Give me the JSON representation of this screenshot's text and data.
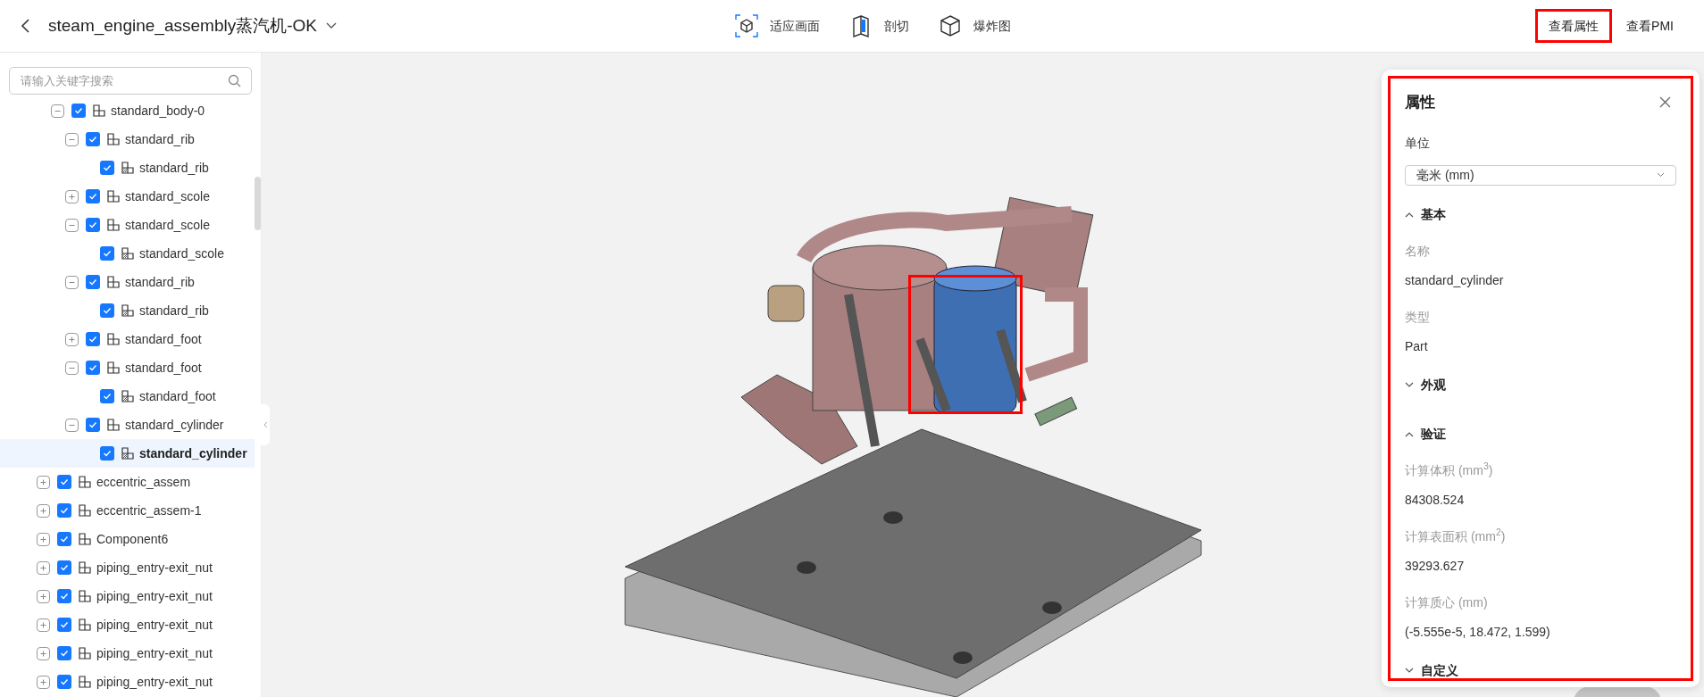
{
  "header": {
    "title": "steam_engine_assembly蒸汽机-OK",
    "tools": [
      {
        "kind": "fit",
        "label": "适应画面"
      },
      {
        "kind": "section",
        "label": "剖切"
      },
      {
        "kind": "explode",
        "label": "爆炸图"
      }
    ],
    "actions": [
      {
        "label": "查看属性",
        "selected": true
      },
      {
        "label": "查看PMI",
        "selected": false
      }
    ]
  },
  "sidebar": {
    "search": {
      "placeholder": "请输入关键字搜索"
    },
    "tree_continued": [
      {
        "label": "standard_body-0",
        "kind": "assembly",
        "expanded": true,
        "checked": true,
        "selected": false,
        "children": [
          {
            "label": "standard_rib",
            "kind": "assembly",
            "expanded": true,
            "checked": true,
            "selected": false,
            "children": [
              {
                "label": "standard_rib",
                "kind": "part",
                "checked": true,
                "selected": false
              }
            ]
          },
          {
            "label": "standard_scole",
            "kind": "assembly",
            "expanded": false,
            "checked": true,
            "selected": false
          },
          {
            "label": "standard_scole",
            "kind": "assembly",
            "expanded": true,
            "checked": true,
            "selected": false,
            "children": [
              {
                "label": "standard_scole",
                "kind": "part",
                "checked": true,
                "selected": false
              }
            ]
          },
          {
            "label": "standard_rib",
            "kind": "assembly",
            "expanded": true,
            "checked": true,
            "selected": false,
            "children": [
              {
                "label": "standard_rib",
                "kind": "part",
                "checked": true,
                "selected": false
              }
            ]
          },
          {
            "label": "standard_foot",
            "kind": "assembly",
            "expanded": false,
            "checked": true,
            "selected": false
          },
          {
            "label": "standard_foot",
            "kind": "assembly",
            "expanded": true,
            "checked": true,
            "selected": false,
            "children": [
              {
                "label": "standard_foot",
                "kind": "part",
                "checked": true,
                "selected": false
              }
            ]
          },
          {
            "label": "standard_cylinder",
            "kind": "assembly",
            "expanded": true,
            "checked": true,
            "selected": false,
            "children": [
              {
                "label": "standard_cylinder",
                "kind": "part",
                "checked": true,
                "selected": true
              }
            ]
          }
        ]
      }
    ],
    "tree": [
      {
        "label": "eccentric_assem",
        "kind": "assembly",
        "expanded": false,
        "checked": true,
        "selected": false
      },
      {
        "label": "eccentric_assem-1",
        "kind": "assembly",
        "expanded": false,
        "checked": true,
        "selected": false
      },
      {
        "label": "Component6",
        "kind": "assembly",
        "expanded": false,
        "checked": true,
        "selected": false
      },
      {
        "label": "piping_entry-exit_nut",
        "kind": "assembly",
        "expanded": false,
        "checked": true,
        "selected": false
      },
      {
        "label": "piping_entry-exit_nut",
        "kind": "assembly",
        "expanded": false,
        "checked": true,
        "selected": false
      },
      {
        "label": "piping_entry-exit_nut",
        "kind": "assembly",
        "expanded": false,
        "checked": true,
        "selected": false
      },
      {
        "label": "piping_entry-exit_nut",
        "kind": "assembly",
        "expanded": false,
        "checked": true,
        "selected": false
      },
      {
        "label": "piping_entry-exit_nut",
        "kind": "assembly",
        "expanded": false,
        "checked": true,
        "selected": false
      }
    ]
  },
  "viewport": {
    "highlight": true
  },
  "panel": {
    "title": "属性",
    "highlight": true,
    "unit_label": "单位",
    "unit_value": "毫米 (mm)",
    "sections": [
      {
        "title": "基本",
        "expanded": true,
        "fields": [
          {
            "label": "名称",
            "value": "standard_cylinder"
          },
          {
            "label": "类型",
            "value": "Part"
          }
        ]
      },
      {
        "title": "外观",
        "expanded": false
      },
      {
        "title": "验证",
        "expanded": true,
        "fields": [
          {
            "label": "计算体积 (mm$^{3}$)",
            "value": "84308.524"
          },
          {
            "label": "计算表面积 (mm$^{2}$)",
            "value": "39293.627"
          },
          {
            "label": "计算质心 (mm)",
            "value": "(-5.555e-5, 18.472, 1.599)"
          }
        ]
      },
      {
        "title": "自定义",
        "expanded": false
      }
    ]
  }
}
